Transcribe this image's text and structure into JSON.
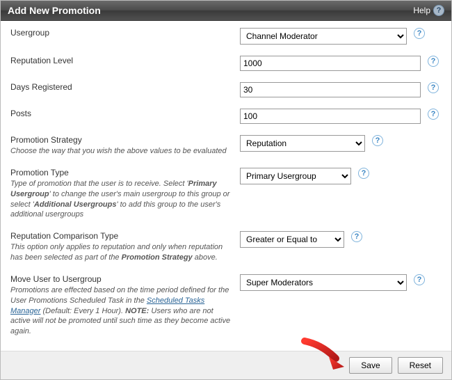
{
  "header": {
    "title": "Add New Promotion",
    "help_label": "Help"
  },
  "rows": {
    "usergroup": {
      "label": "Usergroup",
      "value": "Channel Moderator"
    },
    "reputation_level": {
      "label": "Reputation Level",
      "value": "1000"
    },
    "days_registered": {
      "label": "Days Registered",
      "value": "30"
    },
    "posts": {
      "label": "Posts",
      "value": "100"
    },
    "strategy": {
      "label": "Promotion Strategy",
      "desc": "Choose the way that you wish the above values to be evaluated",
      "value": "Reputation"
    },
    "type": {
      "label": "Promotion Type",
      "desc_pre": "Type of promotion that the user is to receive. Select '",
      "desc_b1": "Primary Usergroup",
      "desc_mid": "' to change the user's main usergroup to this group or select '",
      "desc_b2": "Additional Usergroups",
      "desc_post": "' to add this group to the user's additional usergroups",
      "value": "Primary Usergroup"
    },
    "comparison": {
      "label": "Reputation Comparison Type",
      "desc_pre": "This option only applies to reputation and only when reputation has been selected as part of the ",
      "desc_b1": "Promotion Strategy",
      "desc_post": " above.",
      "value": "Greater or Equal to"
    },
    "move": {
      "label": "Move User to Usergroup",
      "desc_pre": "Promotions are effected based on the time period defined for the User Promotions Scheduled Task in the ",
      "desc_link": "Scheduled Tasks Manager",
      "desc_mid": " (Default: Every 1 Hour). ",
      "desc_b1": "NOTE:",
      "desc_post": " Users who are not active will not be promoted until such time as they become active again.",
      "value": "Super Moderators"
    }
  },
  "footer": {
    "save": "Save",
    "reset": "Reset"
  }
}
